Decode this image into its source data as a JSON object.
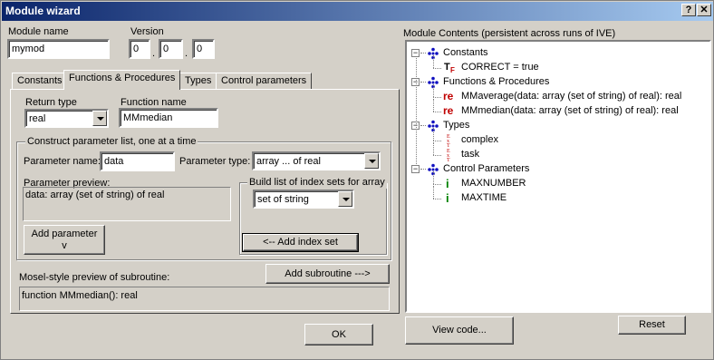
{
  "window": {
    "title": "Module wizard",
    "help_label": "?",
    "close_label": "✕"
  },
  "module": {
    "name_label": "Module name",
    "name_value": "mymod",
    "version_label": "Version",
    "version": [
      "0",
      "0",
      "0"
    ],
    "version_sep": "."
  },
  "tabs": [
    {
      "label": "Constants",
      "active": false
    },
    {
      "label": "Functions & Procedures",
      "active": true
    },
    {
      "label": "Types",
      "active": false
    },
    {
      "label": "Control parameters",
      "active": false
    }
  ],
  "functions": {
    "return_type_label": "Return type",
    "return_type_value": "real",
    "function_name_label": "Function name",
    "function_name_value": "MMmedian",
    "param_group_title": "Construct parameter list, one at a time",
    "param_name_label": "Parameter name:",
    "param_name_value": "data",
    "param_type_label": "Parameter type:",
    "param_type_value": "array ... of real",
    "param_preview_label": "Parameter preview:",
    "param_preview_value": "data: array (set of string)  of real",
    "index_group_title": "Build list of index sets for array",
    "index_set_value": "set of string",
    "add_index_set_label": "<-- Add index set",
    "add_parameter_label": "Add parameter",
    "add_parameter_arrow": "v",
    "add_subroutine_label": "Add subroutine --->",
    "mosel_preview_label": "Mosel-style preview of subroutine:",
    "mosel_preview_value": "function MMmedian(): real"
  },
  "buttons": {
    "ok_label": "OK",
    "view_code_label": "View code...",
    "reset_label": "Reset"
  },
  "contents": {
    "title": "Module Contents (persistent across runs of IVE)",
    "tree": [
      {
        "kind": "category",
        "label": "Constants",
        "icon": "cluster-dots-icon",
        "expander": "−"
      },
      {
        "kind": "leaf",
        "label": "CORRECT = true",
        "icon": "tf-boolean-icon",
        "glyph": "T"
      },
      {
        "kind": "category",
        "label": "Functions & Procedures",
        "icon": "cluster-dots-icon",
        "expander": "−"
      },
      {
        "kind": "leaf",
        "label": "MMaverage(data: array (set of string)  of real): real",
        "icon": "real-function-icon",
        "glyph": "re"
      },
      {
        "kind": "leaf",
        "label": "MMmedian(data: array (set of string)  of real): real",
        "icon": "real-function-icon",
        "glyph": "re"
      },
      {
        "kind": "category",
        "label": "Types",
        "icon": "cluster-dots-icon",
        "expander": "−"
      },
      {
        "kind": "leaf",
        "label": "complex",
        "icon": "text-type-icon",
        "glyph": "T"
      },
      {
        "kind": "leaf",
        "label": "task",
        "icon": "text-type-icon",
        "glyph": "T"
      },
      {
        "kind": "category",
        "label": "Control Parameters",
        "icon": "cluster-dots-icon",
        "expander": "−"
      },
      {
        "kind": "leaf",
        "label": "MAXNUMBER",
        "icon": "integer-param-icon",
        "glyph": "i"
      },
      {
        "kind": "leaf",
        "label": "MAXTIME",
        "icon": "integer-param-icon",
        "glyph": "i"
      }
    ]
  },
  "colors": {
    "titlebar_start": "#0a246a",
    "titlebar_end": "#a6caf0",
    "face": "#d4d0c8",
    "category_icon": "#1010c0",
    "real_icon": "#c00000",
    "int_icon": "#008000"
  }
}
